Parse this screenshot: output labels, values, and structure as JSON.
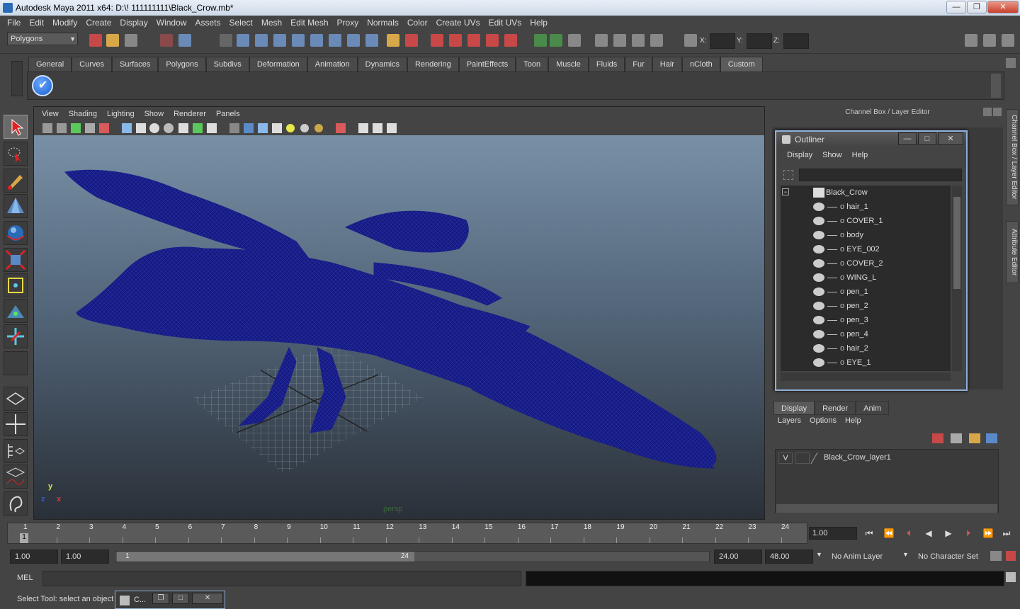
{
  "window": {
    "title": "Autodesk Maya 2011 x64: D:\\! 111111111\\Black_Crow.mb*",
    "minimize": "—",
    "maximize": "❐",
    "close": "✕"
  },
  "menubar": [
    "File",
    "Edit",
    "Modify",
    "Create",
    "Display",
    "Window",
    "Assets",
    "Select",
    "Mesh",
    "Edit Mesh",
    "Proxy",
    "Normals",
    "Color",
    "Create UVs",
    "Edit UVs",
    "Help"
  ],
  "statusline": {
    "mode": "Polygons",
    "x_label": "X:",
    "y_label": "Y:",
    "z_label": "Z:"
  },
  "shelf": {
    "tabs": [
      "General",
      "Curves",
      "Surfaces",
      "Polygons",
      "Subdivs",
      "Deformation",
      "Animation",
      "Dynamics",
      "Rendering",
      "PaintEffects",
      "Toon",
      "Muscle",
      "Fluids",
      "Fur",
      "Hair",
      "nCloth",
      "Custom"
    ],
    "active_tab": "Custom"
  },
  "viewport": {
    "menu": [
      "View",
      "Shading",
      "Lighting",
      "Show",
      "Renderer",
      "Panels"
    ],
    "camera": "persp",
    "axis_x": "x",
    "axis_y": "y",
    "axis_z": "z"
  },
  "right_panel": {
    "header": "Channel Box / Layer Editor",
    "side_tab_1": "Channel Box / Layer Editor",
    "side_tab_2": "Attribute Editor"
  },
  "outliner": {
    "title": "Outliner",
    "menu": [
      "Display",
      "Show",
      "Help"
    ],
    "root": "Black_Crow",
    "items": [
      "hair_1",
      "COVER_1",
      "body",
      "EYE_002",
      "COVER_2",
      "WING_L",
      "pen_1",
      "pen_2",
      "pen_3",
      "pen_4",
      "hair_2",
      "EYE_1"
    ]
  },
  "layer_editor": {
    "tabs": [
      "Display",
      "Render",
      "Anim"
    ],
    "active_tab": "Display",
    "menu": [
      "Layers",
      "Options",
      "Help"
    ],
    "layer_visible": "V",
    "layer_name": "Black_Crow_layer1"
  },
  "timeline": {
    "ticks": [
      "1",
      "2",
      "3",
      "4",
      "5",
      "6",
      "7",
      "8",
      "9",
      "10",
      "11",
      "12",
      "13",
      "14",
      "15",
      "16",
      "17",
      "18",
      "19",
      "20",
      "21",
      "22",
      "23",
      "24"
    ],
    "current_frame_marker": "1",
    "current_time": "1.00"
  },
  "range": {
    "start_time": "1.00",
    "playback_start": "1.00",
    "handle_start": "1",
    "handle_end": "24",
    "playback_end": "24.00",
    "end_time": "48.00",
    "anim_layer": "No Anim Layer",
    "character_set": "No Character Set"
  },
  "command_line": {
    "label": "MEL"
  },
  "help_line": {
    "text": "Select Tool: select an object",
    "minimized_window": "C..."
  },
  "colors": {
    "ui_background": "#444444",
    "mesh_wireframe": "#1a1f8a",
    "accent": "#8fb0d8"
  }
}
